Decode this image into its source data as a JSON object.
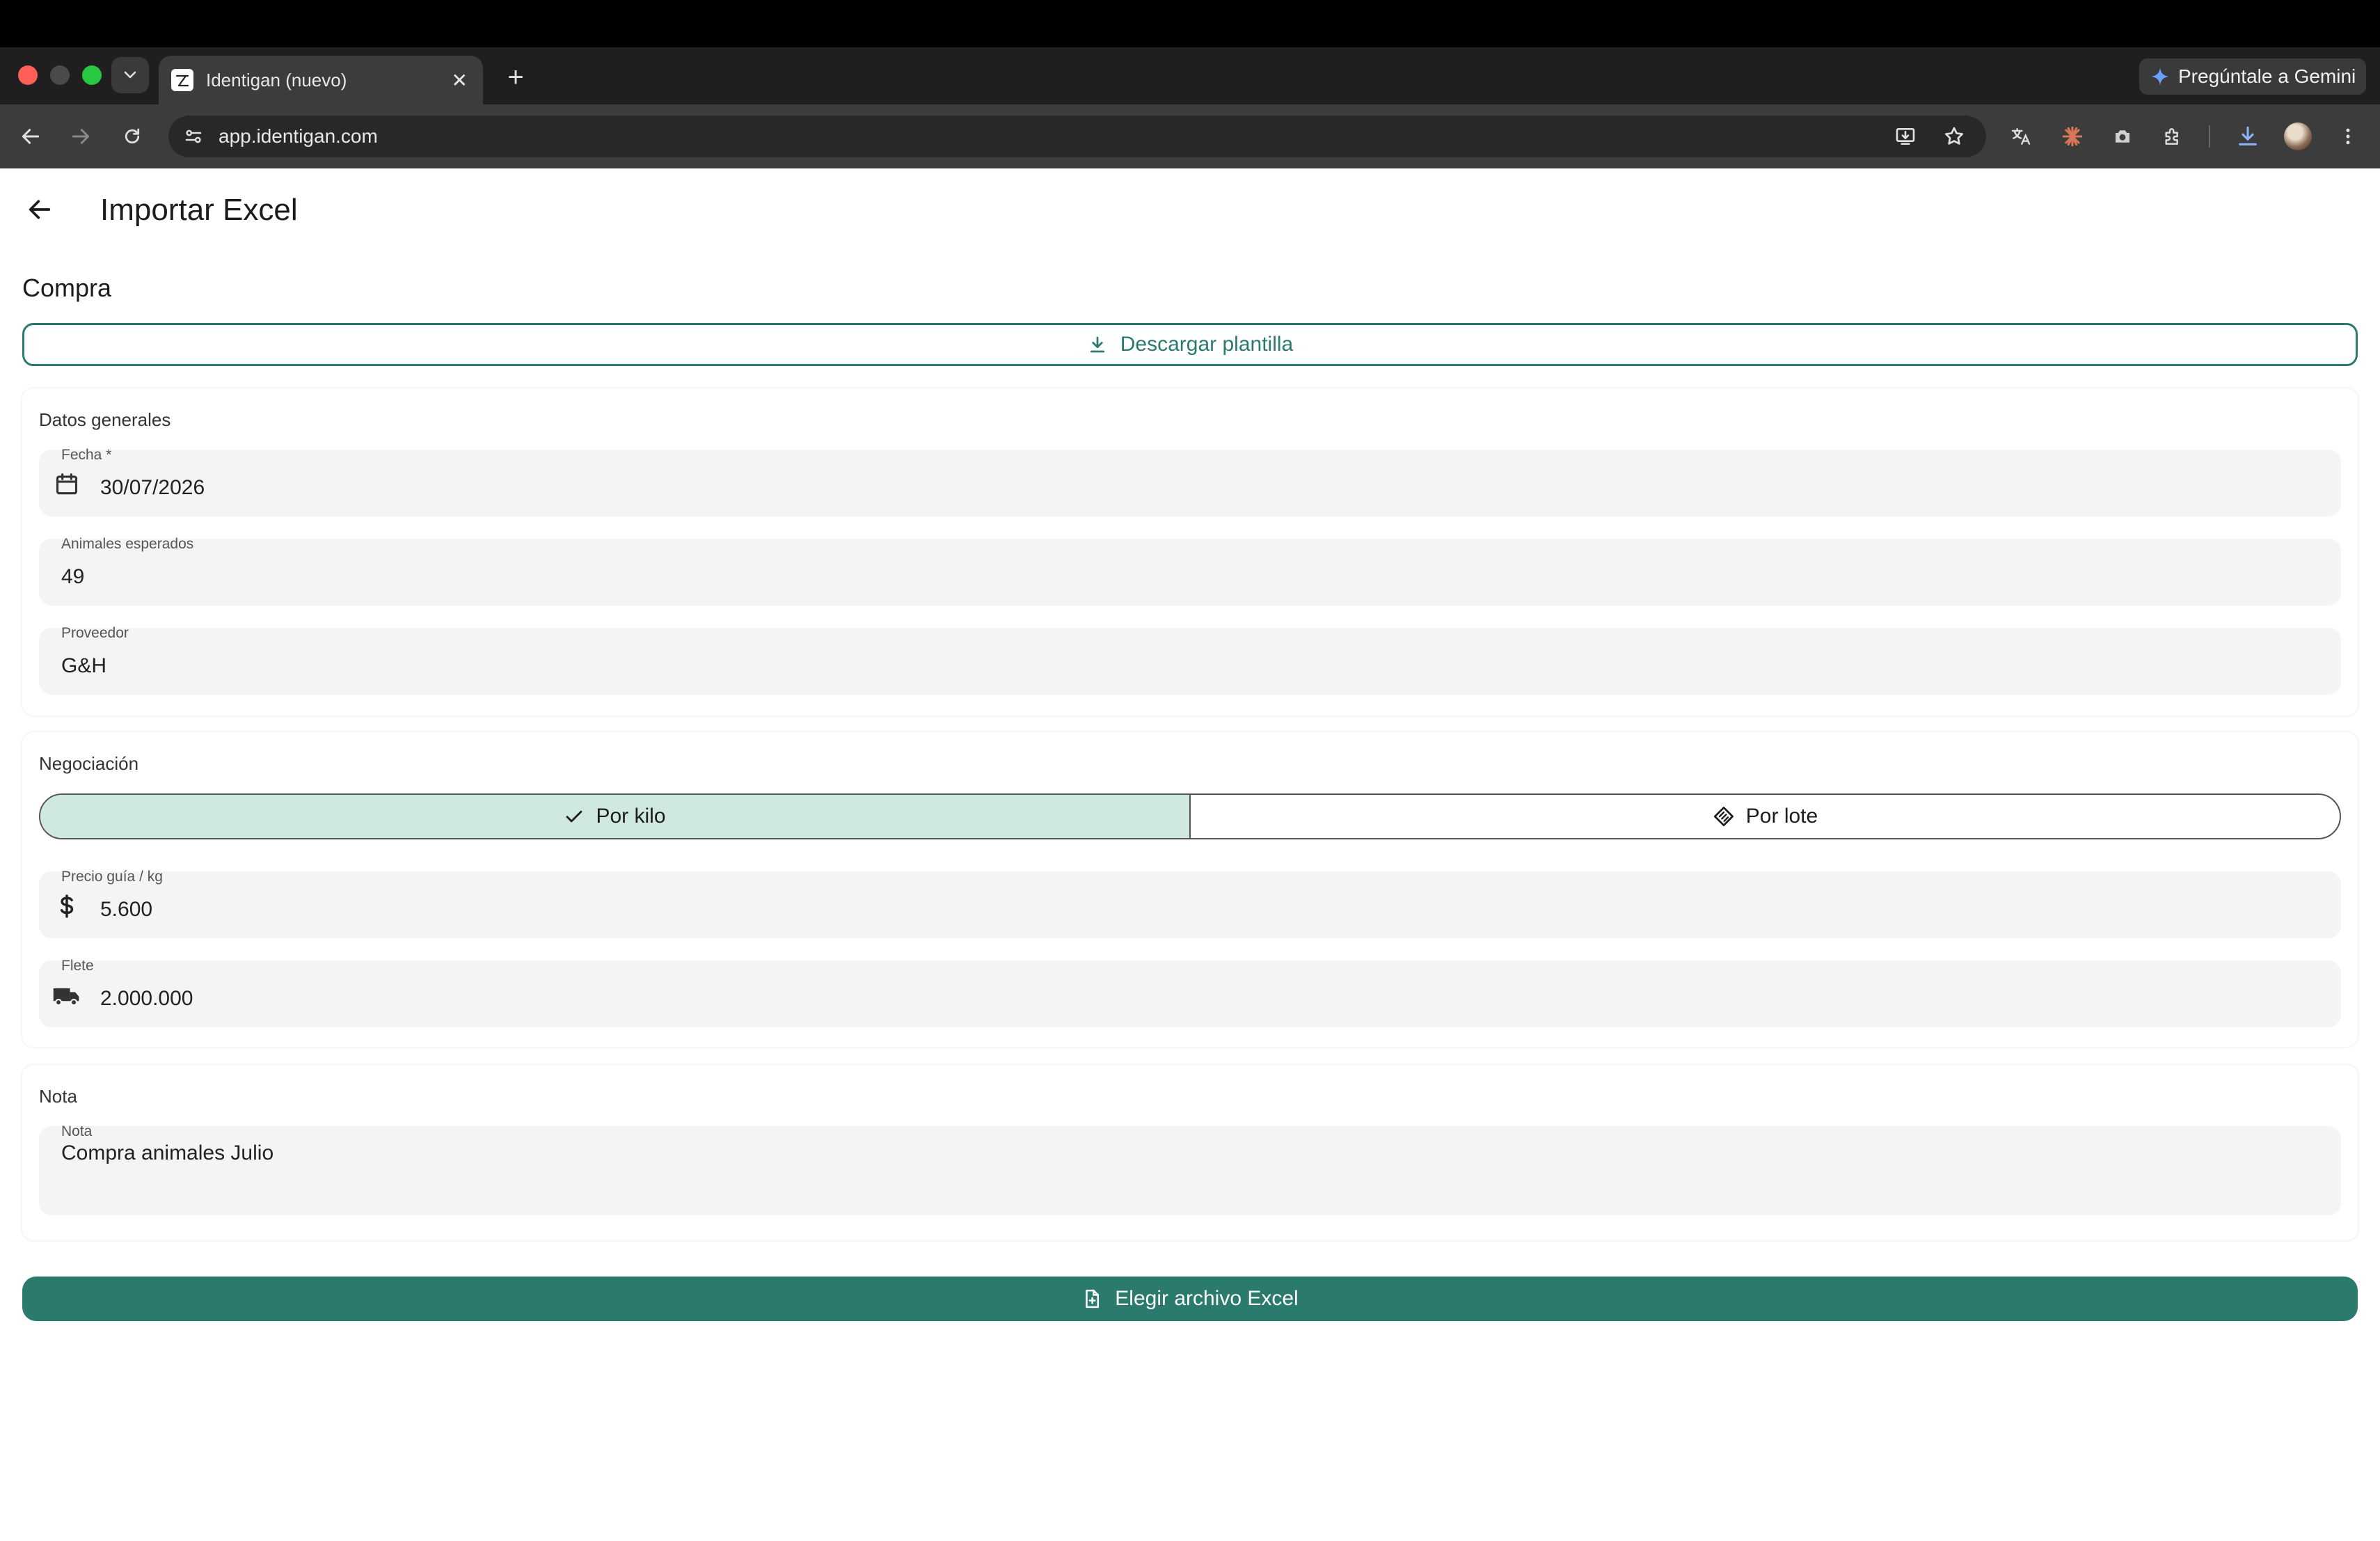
{
  "browser": {
    "tab_title": "Identigan (nuevo)",
    "tab_close": "✕",
    "new_tab": "+",
    "url": "app.identigan.com",
    "gemini_label": "Pregúntale a Gemini"
  },
  "app": {
    "page_title": "Importar Excel",
    "section_title": "Compra",
    "download_template_label": "Descargar plantilla",
    "general": {
      "title": "Datos generales",
      "fecha_label": "Fecha *",
      "fecha_value": "30/07/2026",
      "animales_label": "Animales esperados",
      "animales_value": "49",
      "proveedor_label": "Proveedor",
      "proveedor_value": "G&H"
    },
    "negociacion": {
      "title": "Negociación",
      "options": [
        {
          "label": "Por kilo",
          "selected": true
        },
        {
          "label": "Por lote",
          "selected": false
        }
      ],
      "precio_label": "Precio guía / kg",
      "precio_value": "5.600",
      "flete_label": "Flete",
      "flete_value": "2.000.000"
    },
    "nota": {
      "title": "Nota",
      "field_label": "Nota",
      "field_value": "Compra animales Julio"
    },
    "choose_file_label": "Elegir archivo Excel"
  },
  "colors": {
    "primary": "#2b7a6e",
    "segment_selected": "#cfe9e2",
    "field_bg": "#f4f4f4"
  }
}
